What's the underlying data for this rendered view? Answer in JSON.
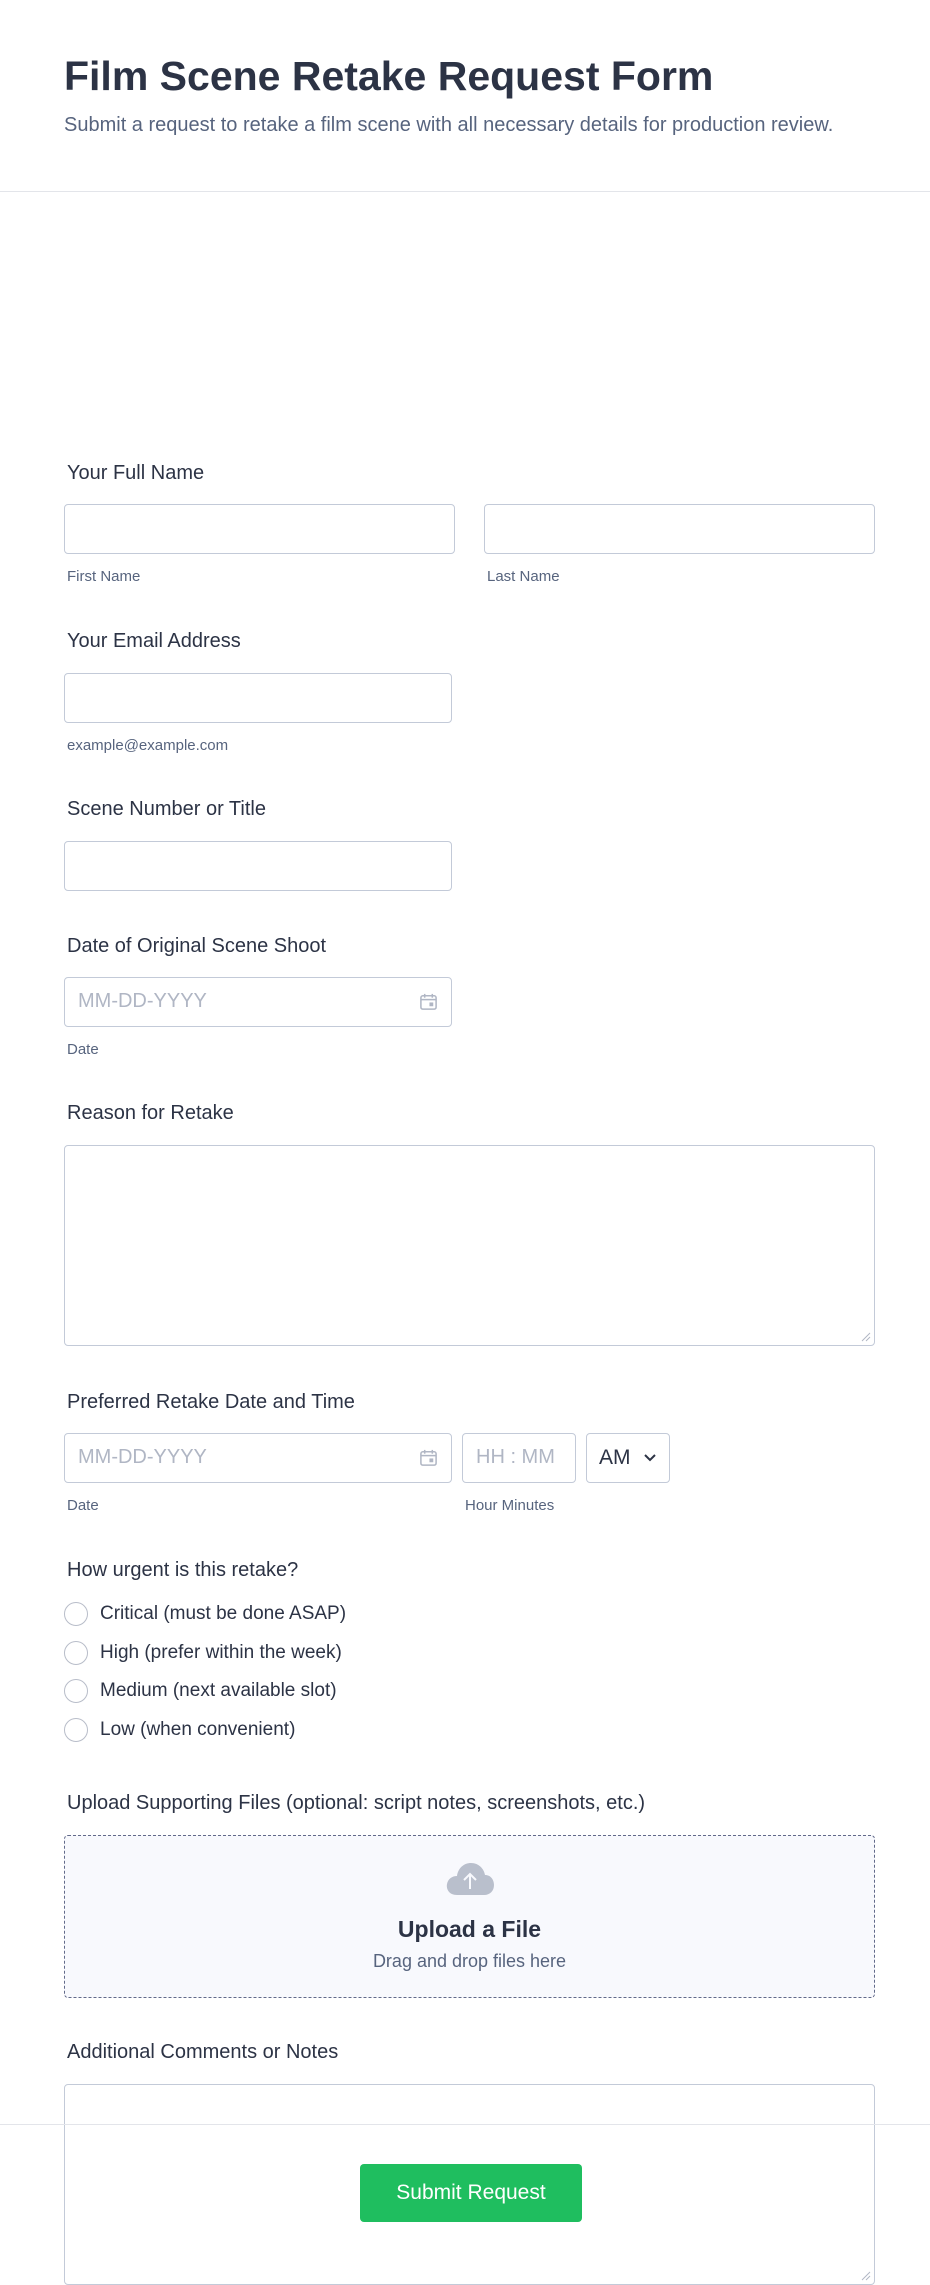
{
  "header": {
    "title": "Film Scene Retake Request Form",
    "subtitle": "Submit a request to retake a film scene with all necessary details for production review."
  },
  "fields": {
    "full_name": {
      "label": "Your Full Name",
      "first_sublabel": "First Name",
      "last_sublabel": "Last Name"
    },
    "email": {
      "label": "Your Email Address",
      "sublabel": "example@example.com"
    },
    "scene": {
      "label": "Scene Number or Title"
    },
    "original_date": {
      "label": "Date of Original Scene Shoot",
      "placeholder": "MM-DD-YYYY",
      "sublabel": "Date"
    },
    "reason": {
      "label": "Reason for Retake"
    },
    "preferred": {
      "label": "Preferred Retake Date and Time",
      "date_placeholder": "MM-DD-YYYY",
      "date_sublabel": "Date",
      "time_placeholder": "HH : MM",
      "time_sublabel": "Hour Minutes",
      "ampm_value": "AM"
    },
    "urgency": {
      "label": "How urgent is this retake?",
      "options": [
        "Critical (must be done ASAP)",
        "High (prefer within the week)",
        "Medium (next available slot)",
        "Low (when convenient)"
      ]
    },
    "upload": {
      "label": "Upload Supporting Files (optional: script notes, screenshots, etc.)",
      "title": "Upload a File",
      "subtitle": "Drag and drop files here"
    },
    "comments": {
      "label": "Additional Comments or Notes"
    }
  },
  "submit": {
    "label": "Submit Request",
    "color": "#1fbe5f"
  },
  "icons": [
    "calendar-icon",
    "cloud-upload-icon",
    "chevron-down-icon",
    "resize-handle-icon"
  ]
}
